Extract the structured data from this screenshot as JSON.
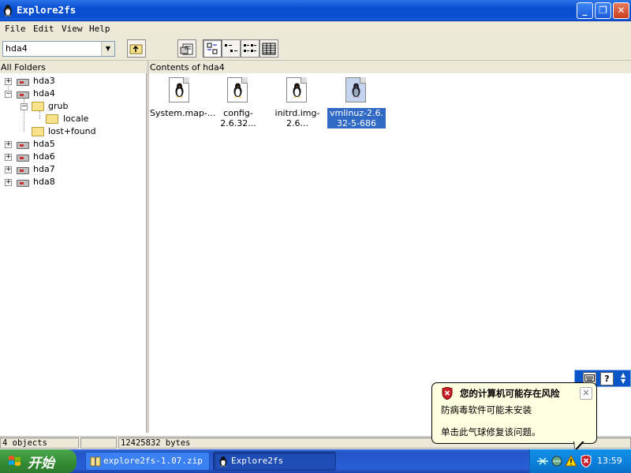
{
  "window": {
    "title": "Explore2fs",
    "btn_min": "_",
    "btn_max": "❐",
    "btn_close": "✕"
  },
  "menu": {
    "file": "File",
    "edit": "Edit",
    "view": "View",
    "help": "Help"
  },
  "toolbar": {
    "path_value": "hda4",
    "combo_arrow": "▼"
  },
  "panes": {
    "folders_header": "All Folders",
    "contents_header": "Contents of hda4"
  },
  "tree": [
    {
      "label": "hda3",
      "expander": "+"
    },
    {
      "label": "hda4",
      "expander": "−"
    },
    {
      "label": "grub",
      "expander": "−"
    },
    {
      "label": "locale"
    },
    {
      "label": "lost+found"
    },
    {
      "label": "hda5",
      "expander": "+"
    },
    {
      "label": "hda6",
      "expander": "+"
    },
    {
      "label": "hda7",
      "expander": "+"
    },
    {
      "label": "hda8",
      "expander": "+"
    }
  ],
  "files": [
    {
      "label": "System.map-..."
    },
    {
      "label": "config-2.6.32..."
    },
    {
      "label": "initrd.img-2.6..."
    },
    {
      "label": "vmlinuz-2.6.32-5-686",
      "selected": true
    }
  ],
  "status": {
    "objects": "4 objects",
    "bytes": "12425832 bytes"
  },
  "taskbar": {
    "start_label": "开始",
    "task_zip": "explore2fs-1.07.zip",
    "task_explore": "Explore2fs",
    "clock": "13:59"
  },
  "balloon": {
    "title": "您的计算机可能存在风险",
    "line1": "防病毒软件可能未安装",
    "line2": "单击此气球修复该问题。",
    "close": "✕"
  },
  "langbar": {
    "help": "?"
  },
  "colors": {
    "selection": "#316ac5",
    "titlebar": "#0a4ed0",
    "start_green": "#338a33"
  }
}
